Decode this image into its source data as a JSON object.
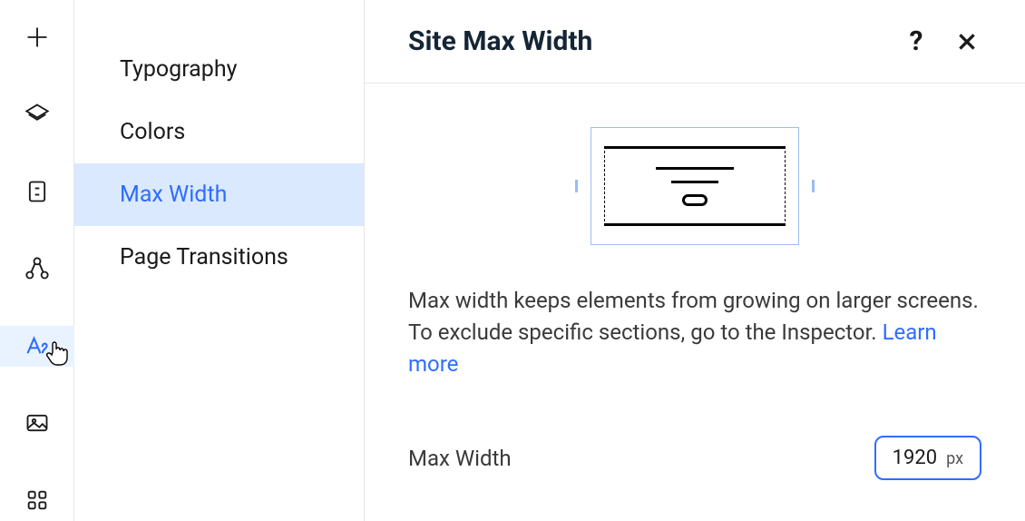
{
  "rail": {
    "items": [
      {
        "name": "add-icon",
        "active": false
      },
      {
        "name": "layers-icon",
        "active": false
      },
      {
        "name": "page-icon",
        "active": false
      },
      {
        "name": "nodes-icon",
        "active": false
      },
      {
        "name": "typography-icon",
        "active": true
      },
      {
        "name": "image-icon",
        "active": false
      },
      {
        "name": "apps-icon",
        "active": false
      }
    ]
  },
  "sidebar": {
    "items": [
      {
        "label": "Typography",
        "active": false
      },
      {
        "label": "Colors",
        "active": false
      },
      {
        "label": "Max Width",
        "active": true
      },
      {
        "label": "Page Transitions",
        "active": false
      }
    ]
  },
  "panel": {
    "title": "Site Max Width",
    "description": "Max width keeps elements from growing on larger screens. To exclude specific sections, go to the Inspector.",
    "learn_more": "Learn more",
    "field_label": "Max Width",
    "field_value": "1920",
    "field_unit": "px"
  }
}
